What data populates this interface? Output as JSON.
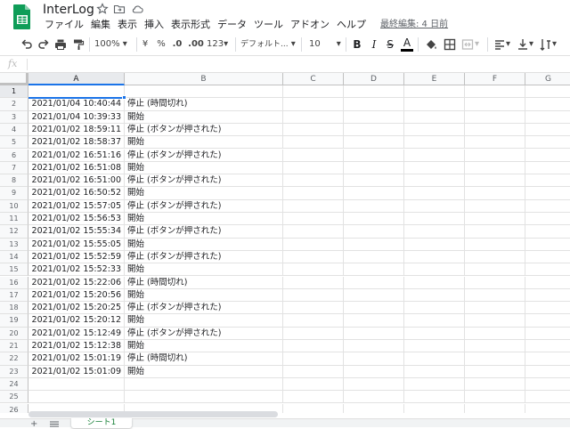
{
  "document": {
    "title": "InterLog",
    "last_edit": "最終編集: 4 日前"
  },
  "menu": [
    "ファイル",
    "編集",
    "表示",
    "挿入",
    "表示形式",
    "データ",
    "ツール",
    "アドオン",
    "ヘルプ"
  ],
  "toolbar": {
    "zoom": "100%",
    "currency": "¥",
    "percent": "%",
    "decrease_decimal": ".0",
    "increase_decimal": ".00",
    "more_formats": "123",
    "font": "デフォルト...",
    "font_size": "10",
    "bold": "B",
    "italic": "I",
    "strike": "S",
    "text_color": "A"
  },
  "formula": {
    "label": "fx",
    "value": ""
  },
  "columns": [
    "A",
    "B",
    "C",
    "D",
    "E",
    "F",
    "G"
  ],
  "row_numbers": [
    "1",
    "2",
    "3",
    "4",
    "5",
    "6",
    "7",
    "8",
    "9",
    "10",
    "11",
    "12",
    "13",
    "14",
    "15",
    "16",
    "17",
    "18",
    "19",
    "20",
    "21",
    "22",
    "23",
    "24",
    "25",
    "26"
  ],
  "rows": [
    {
      "a": "",
      "b": ""
    },
    {
      "a": "2021/01/04 10:40:44",
      "b": "停止 (時間切れ)"
    },
    {
      "a": "2021/01/04 10:39:33",
      "b": "開始"
    },
    {
      "a": "2021/01/02 18:59:11",
      "b": "停止 (ボタンが押された)"
    },
    {
      "a": "2021/01/02 18:58:37",
      "b": "開始"
    },
    {
      "a": "2021/01/02 16:51:16",
      "b": "停止 (ボタンが押された)"
    },
    {
      "a": "2021/01/02 16:51:08",
      "b": "開始"
    },
    {
      "a": "2021/01/02 16:51:00",
      "b": "停止 (ボタンが押された)"
    },
    {
      "a": "2021/01/02 16:50:52",
      "b": "開始"
    },
    {
      "a": "2021/01/02 15:57:05",
      "b": "停止 (ボタンが押された)"
    },
    {
      "a": "2021/01/02 15:56:53",
      "b": "開始"
    },
    {
      "a": "2021/01/02 15:55:34",
      "b": "停止 (ボタンが押された)"
    },
    {
      "a": "2021/01/02 15:55:05",
      "b": "開始"
    },
    {
      "a": "2021/01/02 15:52:59",
      "b": "停止 (ボタンが押された)"
    },
    {
      "a": "2021/01/02 15:52:33",
      "b": "開始"
    },
    {
      "a": "2021/01/02 15:22:06",
      "b": "停止 (時間切れ)"
    },
    {
      "a": "2021/01/02 15:20:56",
      "b": "開始"
    },
    {
      "a": "2021/01/02 15:20:25",
      "b": "停止 (ボタンが押された)"
    },
    {
      "a": "2021/01/02 15:20:12",
      "b": "開始"
    },
    {
      "a": "2021/01/02 15:12:49",
      "b": "停止 (ボタンが押された)"
    },
    {
      "a": "2021/01/02 15:12:38",
      "b": "開始"
    },
    {
      "a": "2021/01/02 15:01:19",
      "b": "停止 (時間切れ)"
    },
    {
      "a": "2021/01/02 15:01:09",
      "b": "開始"
    },
    {
      "a": "",
      "b": ""
    },
    {
      "a": "",
      "b": ""
    },
    {
      "a": "",
      "b": ""
    }
  ],
  "sheet": {
    "add_label": "+",
    "active_tab": "シート1"
  },
  "colors": {
    "accent": "#1a73e8",
    "sheets_green": "#0f9d58"
  },
  "icons": [
    "sheets-logo-icon",
    "star-icon",
    "move-to-folder-icon",
    "cloud-status-icon",
    "undo-icon",
    "redo-icon",
    "print-icon",
    "paint-format-icon",
    "fill-color-icon",
    "borders-icon",
    "merge-icon",
    "align-icon",
    "valign-icon",
    "text-rotation-icon"
  ]
}
